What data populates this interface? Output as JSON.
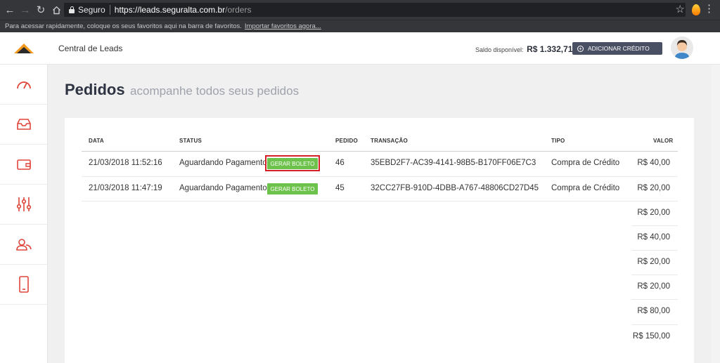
{
  "browser": {
    "secure_label": "Seguro",
    "url_host": "https://leads.seguralta.com.br",
    "url_path": "/orders",
    "bookmarks_text": "Para acessar rapidamente, coloque os seus favoritos aqui na barra de favoritos.",
    "bookmarks_link": "Importar favoritos agora..."
  },
  "header": {
    "title": "Central de Leads",
    "balance_label": "Saldo disponível:",
    "balance_value": "R$ 1.332,71",
    "add_credit_label": "ADICIONAR CRÉDITO",
    "accent_color": "#4a5064"
  },
  "sidebar": {
    "items": [
      {
        "icon": "dashboard-gauge-icon"
      },
      {
        "icon": "inbox-icon"
      },
      {
        "icon": "wallet-icon"
      },
      {
        "icon": "settings-sliders-icon"
      },
      {
        "icon": "users-icon"
      },
      {
        "icon": "mobile-phone-icon"
      }
    ],
    "icon_color": "#e0453a"
  },
  "page": {
    "title": "Pedidos",
    "subtitle": "acompanhe todos seus pedidos"
  },
  "table": {
    "headers": {
      "data": "DATA",
      "status": "STATUS",
      "pedido": "PEDIDO",
      "transacao": "TRANSAÇÃO",
      "tipo": "TIPO",
      "valor": "VALOR"
    },
    "rows": [
      {
        "data": "21/03/2018 11:52:16",
        "status": "Aguardando Pagamento",
        "button": "GERAR BOLETO",
        "pedido": "46",
        "transacao": "35EBD2F7-AC39-4141-98B5-B170FF06E7C3",
        "tipo": "Compra de Crédito",
        "valor": "R$ 40,00"
      },
      {
        "data": "21/03/2018 11:47:19",
        "status": "Aguardando Pagamento",
        "button": "GERAR BOLETO",
        "pedido": "45",
        "transacao": "32CC27FB-910D-4DBB-A767-48806CD27D45",
        "tipo": "Compra de Crédito",
        "valor": "R$ 20,00"
      }
    ],
    "extra_values": [
      "R$ 20,00",
      "R$ 40,00",
      "R$ 20,00",
      "R$ 20,00",
      "R$ 80,00",
      "R$ 150,00"
    ],
    "button_color": "#6dc24b",
    "highlight_color": "#d32025"
  }
}
